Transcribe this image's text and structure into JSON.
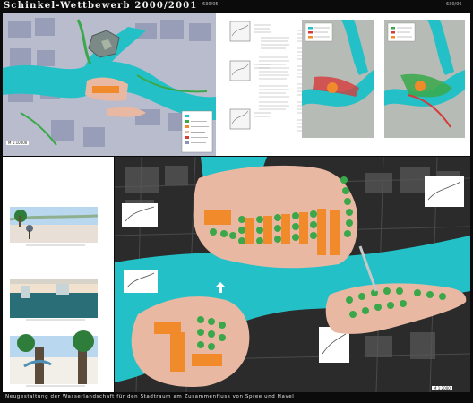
{
  "header": {
    "title": "Schinkel-Wettbewerb 2000/2001",
    "page_left": "630/05",
    "page_right": "630/06"
  },
  "scale": {
    "left_panel": "M 1:10000",
    "big_plan": "M 1:2000"
  },
  "footer": {
    "text": "Neugestaltung der Wasserlandschaft für den Stadtraum am Zusammenfluss von Spree und Havel"
  },
  "colors": {
    "water": "#23c1c7",
    "plaza": "#e8b8a2",
    "building": "#f08a2a",
    "trees": "#3aa84a",
    "city": "#a7acc8"
  }
}
